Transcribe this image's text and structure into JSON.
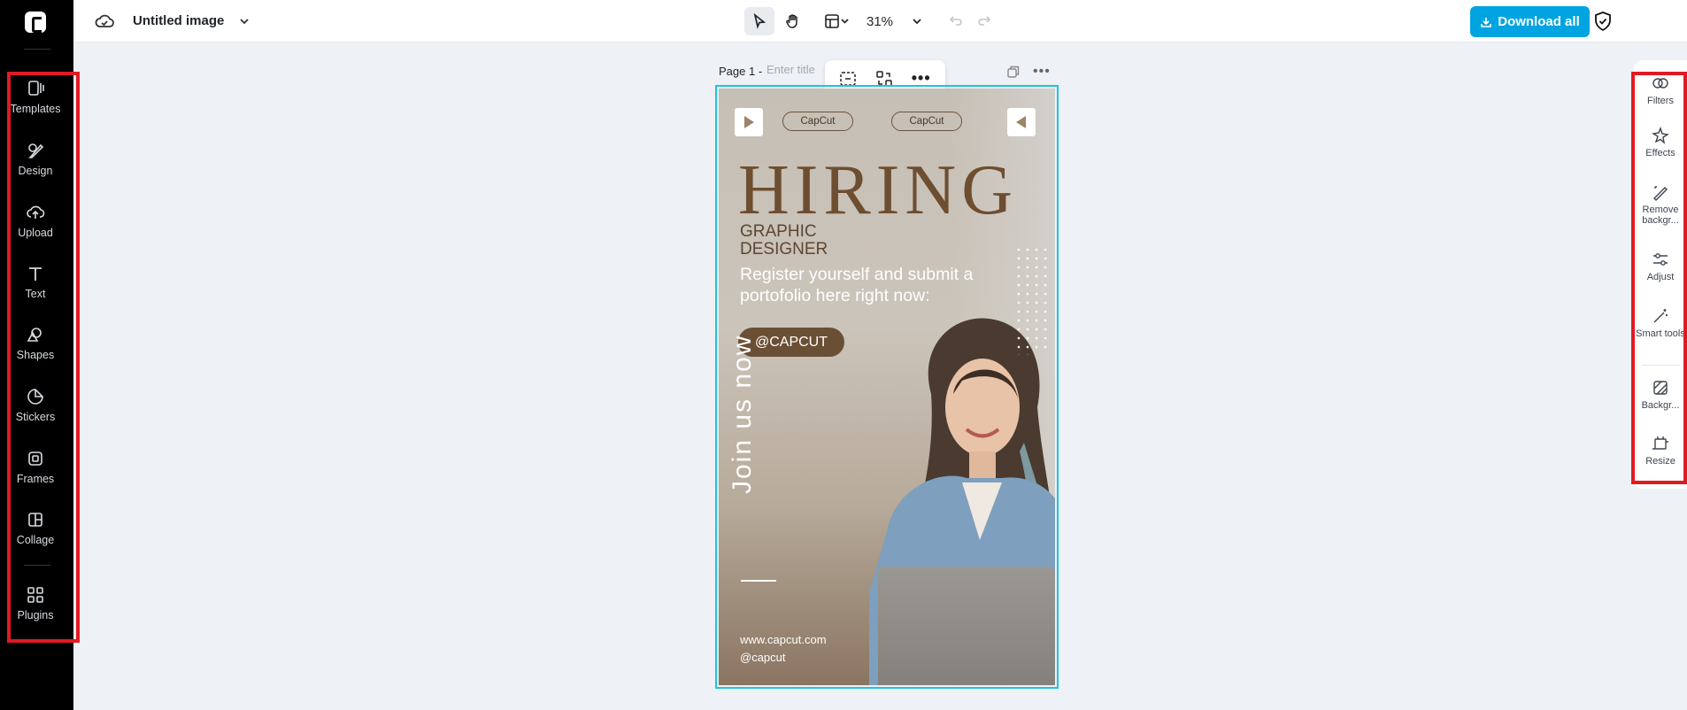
{
  "app": {
    "title": "Untitled image",
    "zoom": "31%",
    "download_label": "Download all"
  },
  "left_sidebar": {
    "items": [
      {
        "label": "Templates",
        "icon": "templates-icon"
      },
      {
        "label": "Design",
        "icon": "design-icon"
      },
      {
        "label": "Upload",
        "icon": "upload-icon"
      },
      {
        "label": "Text",
        "icon": "text-icon"
      },
      {
        "label": "Shapes",
        "icon": "shapes-icon"
      },
      {
        "label": "Stickers",
        "icon": "stickers-icon"
      },
      {
        "label": "Frames",
        "icon": "frames-icon"
      },
      {
        "label": "Collage",
        "icon": "collage-icon"
      },
      {
        "label": "Plugins",
        "icon": "plugins-icon"
      }
    ]
  },
  "page": {
    "label": "Page 1 -",
    "title_placeholder": "Enter title"
  },
  "poster": {
    "pill_left": "CapCut",
    "pill_right": "CapCut",
    "headline": "HIRING",
    "subhead_line1": "GRAPHIC",
    "subhead_line2": "DESIGNER",
    "body": "Register yourself and submit a portofolio here right now:",
    "button": "@CAPCUT",
    "vertical": "Join us now",
    "website": "www.capcut.com",
    "handle": "@capcut"
  },
  "right_panel": {
    "items": [
      {
        "label": "Filters",
        "icon": "filters-icon"
      },
      {
        "label": "Effects",
        "icon": "effects-icon"
      },
      {
        "label": "Remove backgr...",
        "icon": "remove-background-icon"
      },
      {
        "label": "Adjust",
        "icon": "adjust-icon"
      },
      {
        "label": "Smart tools",
        "icon": "smart-tools-icon"
      },
      {
        "label": "Backgr...",
        "icon": "background-icon"
      },
      {
        "label": "Resize",
        "icon": "resize-icon"
      }
    ]
  },
  "colors": {
    "accent": "#00a4e0",
    "highlight": "#e11a22",
    "selection": "#1dc3e0"
  }
}
